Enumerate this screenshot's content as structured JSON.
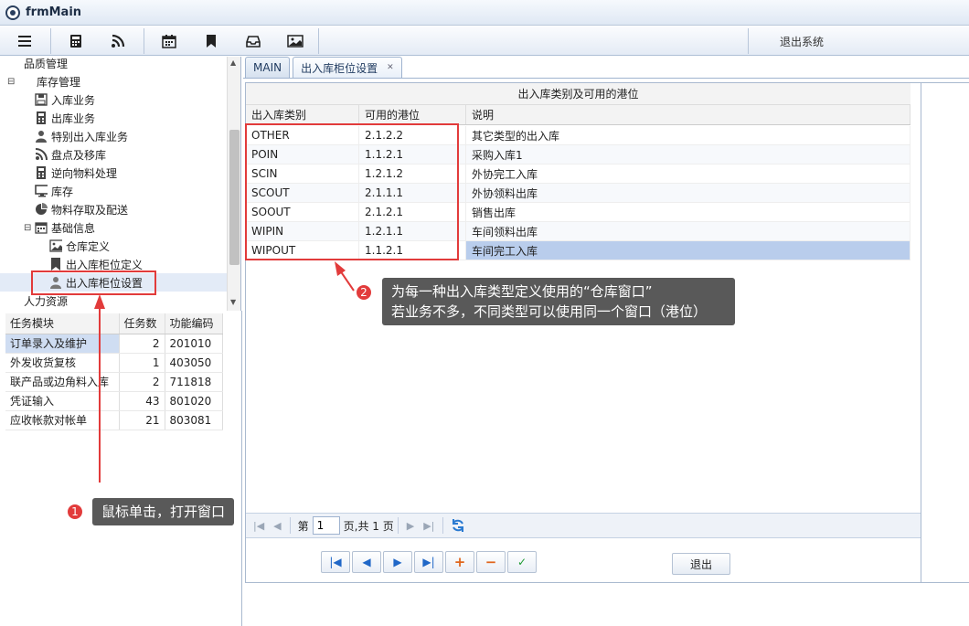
{
  "window": {
    "title": "frmMain"
  },
  "toolbar": {
    "exit_label": "退出系统",
    "icons": [
      "menu-icon",
      "calculator-icon",
      "rss-icon",
      "calendar-icon",
      "bookmark-icon",
      "inbox-icon",
      "image-icon"
    ]
  },
  "tree": {
    "items": [
      {
        "label": "品质管理",
        "icon": "",
        "level": 1
      },
      {
        "label": "库存管理",
        "icon": "expand",
        "level": 0
      },
      {
        "label": "入库业务",
        "icon": "save-icon",
        "level": 2
      },
      {
        "label": "出库业务",
        "icon": "calculator-icon",
        "level": 2
      },
      {
        "label": "特别出入库业务",
        "icon": "user-icon",
        "level": 2
      },
      {
        "label": "盘点及移库",
        "icon": "rss-icon",
        "level": 2
      },
      {
        "label": "逆向物料处理",
        "icon": "calculator-icon",
        "level": 2
      },
      {
        "label": "库存",
        "icon": "monitor-icon",
        "level": 2
      },
      {
        "label": "物料存取及配送",
        "icon": "pie-chart-icon",
        "level": 2
      },
      {
        "label": "基础信息",
        "icon": "calendar-icon",
        "level": 2
      },
      {
        "label": "仓库定义",
        "icon": "image-icon",
        "level": 3
      },
      {
        "label": "出入库柜位定义",
        "icon": "bookmark-icon",
        "level": 3
      },
      {
        "label": "出入库柜位设置",
        "icon": "user-icon",
        "level": 3
      },
      {
        "label": "人力资源",
        "icon": "",
        "level": 1
      }
    ]
  },
  "tasks": {
    "headers": [
      "任务模块",
      "任务数",
      "功能编码"
    ],
    "rows": [
      [
        "订单录入及维护",
        "2",
        "201010"
      ],
      [
        "外发收货复核",
        "1",
        "403050"
      ],
      [
        "联产品或边角料入库",
        "2",
        "711818"
      ],
      [
        "凭证输入",
        "43",
        "801020"
      ],
      [
        "应收帐款对帐单",
        "21",
        "803081"
      ]
    ]
  },
  "tabs": [
    {
      "label": "MAIN"
    },
    {
      "label": "出入库柜位设置",
      "closable": true
    }
  ],
  "grid": {
    "group_header": "出入库类别及可用的港位",
    "headers": [
      "出入库类别",
      "可用的港位",
      "说明"
    ],
    "rows": [
      [
        "OTHER",
        "2.1.2.2",
        "其它类型的出入库"
      ],
      [
        "POIN",
        "1.1.2.1",
        "采购入库1"
      ],
      [
        "SCIN",
        "1.2.1.2",
        "外协完工入库"
      ],
      [
        "SCOUT",
        "2.1.1.1",
        "外协领料出库"
      ],
      [
        "SOOUT",
        "2.1.2.1",
        "销售出库"
      ],
      [
        "WIPIN",
        "1.2.1.1",
        "车间领料出库"
      ],
      [
        "WIPOUT",
        "1.1.2.1",
        "车间完工入库"
      ]
    ]
  },
  "pager": {
    "page_prefix": "第",
    "page_value": "1",
    "page_suffix": "页,共 1 页"
  },
  "nav": {
    "exit_label": "退出"
  },
  "callouts": {
    "c1": {
      "badge": "1",
      "text": "鼠标单击，打开窗口"
    },
    "c2": {
      "badge": "2",
      "line1": "为每一种出入库类型定义使用的“仓库窗口”",
      "line2": "若业务不多，不同类型可以使用同一个窗口（港位）"
    }
  },
  "colors": {
    "accent": "#e23b3b",
    "callout_bg": "#595959",
    "selection": "#b9cdec"
  }
}
